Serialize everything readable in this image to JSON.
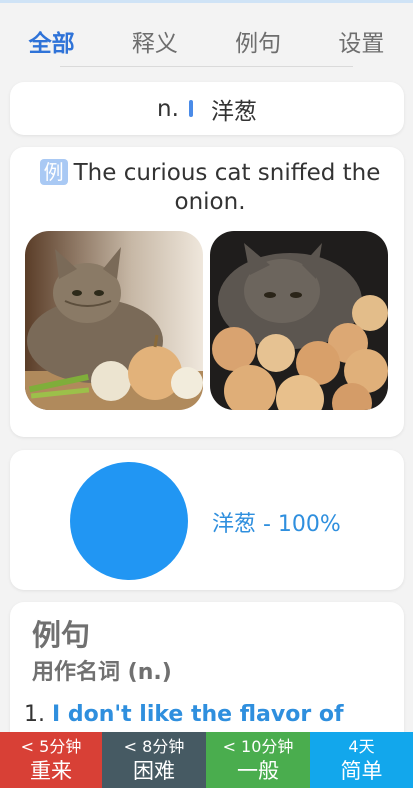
{
  "tabs": [
    {
      "label": "全部",
      "active": true
    },
    {
      "label": "释义",
      "active": false
    },
    {
      "label": "例句",
      "active": false
    },
    {
      "label": "设置",
      "active": false
    }
  ],
  "definition": {
    "pos": "n.",
    "meaning": "洋葱"
  },
  "example": {
    "badge": "例",
    "sentence": "The curious cat sniffed the onion."
  },
  "chart_data": {
    "type": "pie",
    "categories": [
      "洋葱"
    ],
    "values": [
      100
    ],
    "label": "洋葱 - 100%",
    "colors": [
      "#2196f3"
    ]
  },
  "sentences": {
    "title": "例句",
    "subtitle": "用作名词 (n.)",
    "items": [
      {
        "num": "1.",
        "text": "I don't like the flavor of"
      }
    ]
  },
  "answer_buttons": [
    {
      "time": "< 5分钟",
      "label": "重来",
      "color": "#d84036"
    },
    {
      "time": "< 8分钟",
      "label": "困难",
      "color": "#465a63"
    },
    {
      "time": "< 10分钟",
      "label": "一般",
      "color": "#4aad4e"
    },
    {
      "time": "4天",
      "label": "简单",
      "color": "#12a7ec"
    }
  ]
}
